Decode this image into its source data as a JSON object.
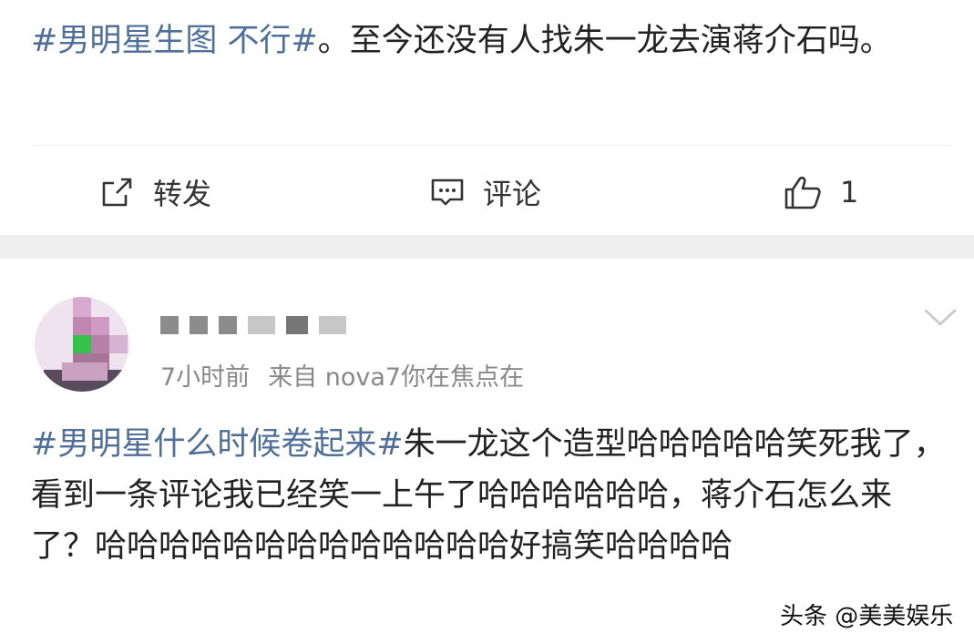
{
  "post1": {
    "topic": "#男明星生图 不行#",
    "text": "。至今还没有人找朱一龙去演蒋介石吗。"
  },
  "actions": {
    "forward_label": "转发",
    "comment_label": "评论",
    "like_count": "1",
    "icons": [
      "share-icon",
      "comment-icon",
      "thumbs-up-icon"
    ]
  },
  "post2": {
    "time": "7小时前",
    "source": "来自 nova7你在焦点在",
    "topic": "#男明星什么时候卷起来#",
    "text": "朱一龙这个造型哈哈哈哈哈笑死我了，看到一条评论我已经笑一上午了哈哈哈哈哈哈，蒋介石怎么来了？哈哈哈哈哈哈哈哈哈哈哈哈哈好搞笑哈哈哈哈"
  },
  "watermark": "头条 @美美娱乐",
  "colors": {
    "topic": "#4f6f98",
    "text": "#222222",
    "meta": "#888888",
    "separator": "#eeeeee"
  }
}
